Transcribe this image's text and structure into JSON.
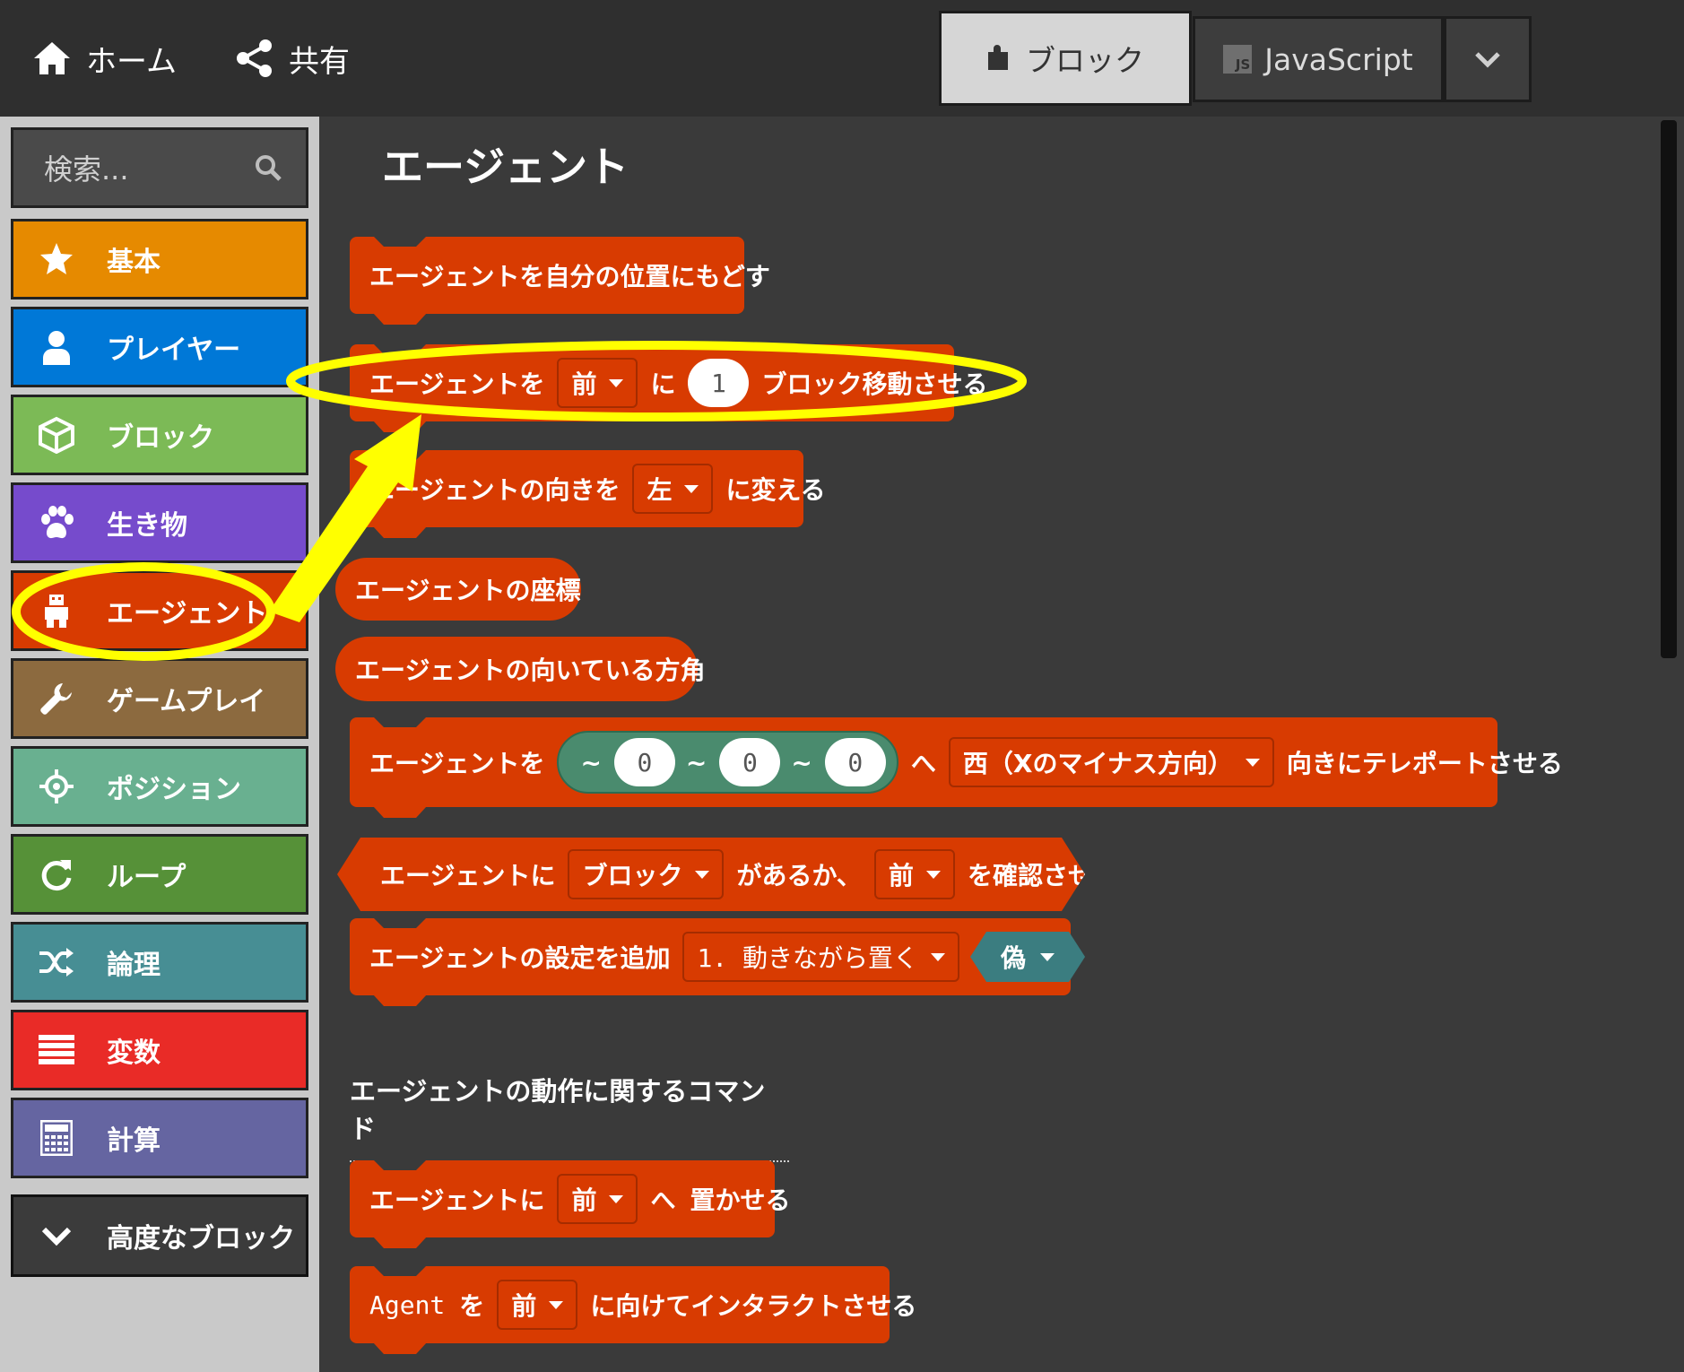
{
  "topbar": {
    "home_label": "ホーム",
    "share_label": "共有",
    "blocks_label": "ブロック",
    "js_label": "JavaScript",
    "js_icon_text": "JS"
  },
  "sidebar": {
    "search_placeholder": "検索...",
    "categories": [
      {
        "label": "基本",
        "color": "#e68a00",
        "icon": "star-icon"
      },
      {
        "label": "プレイヤー",
        "color": "#0078d7",
        "icon": "person-icon"
      },
      {
        "label": "ブロック",
        "color": "#7cba56",
        "icon": "cube-icon"
      },
      {
        "label": "生き物",
        "color": "#764bcc",
        "icon": "paw-icon"
      },
      {
        "label": "エージェント",
        "color": "#d83b01",
        "icon": "agent-icon"
      },
      {
        "label": "ゲームプレイ",
        "color": "#8c6a3f",
        "icon": "wrench-icon"
      },
      {
        "label": "ポジション",
        "color": "#69b090",
        "icon": "crosshair-icon"
      },
      {
        "label": "ループ",
        "color": "#569138",
        "icon": "loop-icon"
      },
      {
        "label": "論理",
        "color": "#478e94",
        "icon": "shuffle-icon"
      },
      {
        "label": "変数",
        "color": "#e92b27",
        "icon": "list-icon"
      },
      {
        "label": "計算",
        "color": "#6565a1",
        "icon": "calculator-icon"
      }
    ],
    "advanced_label": "高度なブロック"
  },
  "workspace": {
    "title": "エージェント",
    "blocks": {
      "return_home": "エージェントを自分の位置にもどす",
      "move_prefix": "エージェントを",
      "move_dir": "前",
      "move_ni": "に",
      "move_count": "1",
      "move_suffix": "ブロック移動させる",
      "turn_prefix": "エージェントの向きを",
      "turn_dir": "左",
      "turn_suffix": "に変える",
      "position": "エージェントの座標",
      "facing": "エージェントの向いている方角",
      "tp_prefix": "エージェントを",
      "tp_tilde": "~",
      "tp_x": "0",
      "tp_y": "0",
      "tp_z": "0",
      "tp_he": "へ",
      "tp_dir": "西（Xのマイナス方向）",
      "tp_suffix": "向きにテレポートさせる",
      "detect_prefix": "エージェントに",
      "detect_kind": "ブロック",
      "detect_mid": "があるか、",
      "detect_dir": "前",
      "detect_suffix": "を確認させる",
      "setting_prefix": "エージェントの設定を追加",
      "setting_option": "1. 動きながら置く",
      "setting_value": "偽",
      "place_prefix": "エージェントに",
      "place_dir": "前",
      "place_he": "へ",
      "place_suffix": "置かせる",
      "interact_agent": "Agent",
      "interact_wo": "を",
      "interact_dir": "前",
      "interact_suffix": "に向けてインタラクトさせる"
    },
    "section_label": "エージェントの動作に関するコマンド"
  },
  "colors": {
    "agent_block": "#d83b01",
    "position_block": "#4a8b6e",
    "logic_bool": "#3b7d80",
    "highlight": "#ffff00"
  }
}
